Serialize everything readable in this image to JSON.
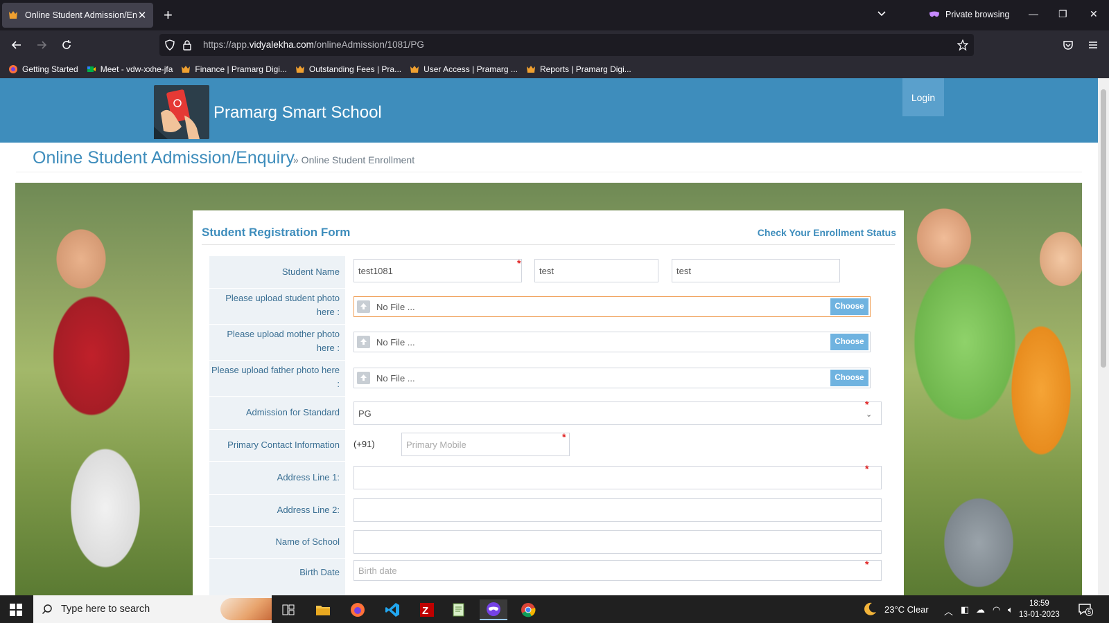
{
  "browser": {
    "tab_title": "Online Student Admission/Enquiry",
    "new_tab_label": "+",
    "private_label": "Private browsing",
    "url_prefix": "https://app.",
    "url_domain": "vidyalekha.com",
    "url_path": "/onlineAdmission/1081/PG",
    "bookmarks": [
      {
        "label": "Getting Started",
        "icon": "firefox-icon"
      },
      {
        "label": "Meet - vdw-xxhe-jfa",
        "icon": "meet-icon"
      },
      {
        "label": "Finance | Pramarg Digi...",
        "icon": "pramarg-icon"
      },
      {
        "label": "Outstanding Fees | Pra...",
        "icon": "pramarg-icon"
      },
      {
        "label": "User Access | Pramarg ...",
        "icon": "pramarg-icon"
      },
      {
        "label": "Reports | Pramarg Digi...",
        "icon": "pramarg-icon"
      }
    ]
  },
  "header": {
    "site_name": "Pramarg Smart School",
    "login_label": "Login"
  },
  "breadcrumb": {
    "title": "Online Student Admission/Enquiry",
    "current": "» Online Student Enrollment"
  },
  "form": {
    "title": "Student Registration Form",
    "status_link": "Check Your Enrollment Status",
    "student_name_label": "Student Name",
    "first_name_value": "test1081",
    "middle_name_value": "test",
    "last_name_value": "test",
    "student_photo_label": "Please upload student photo here :",
    "mother_photo_label": "Please upload mother photo here :",
    "father_photo_label": "Please upload father photo here :",
    "no_file_text": "No File ...",
    "choose_label": "Choose",
    "standard_label": "Admission for Standard",
    "standard_value": "PG",
    "contact_label": "Primary Contact Information",
    "country_code": "(+91)",
    "mobile_placeholder": "Primary Mobile",
    "address1_label": "Address Line 1:",
    "address2_label": "Address Line 2:",
    "school_label": "Name of School",
    "birth_date_label": "Birth Date",
    "birth_date_placeholder": "Birth date",
    "required_mark": "*"
  },
  "taskbar": {
    "search_text": "Type here to search",
    "weather": "23°C  Clear",
    "time": "18:59",
    "date": "13-01-2023",
    "notifications": "5"
  },
  "colors": {
    "accent": "#3e8dbc",
    "choose_button": "#6fb3e0",
    "required": "#e02020"
  }
}
